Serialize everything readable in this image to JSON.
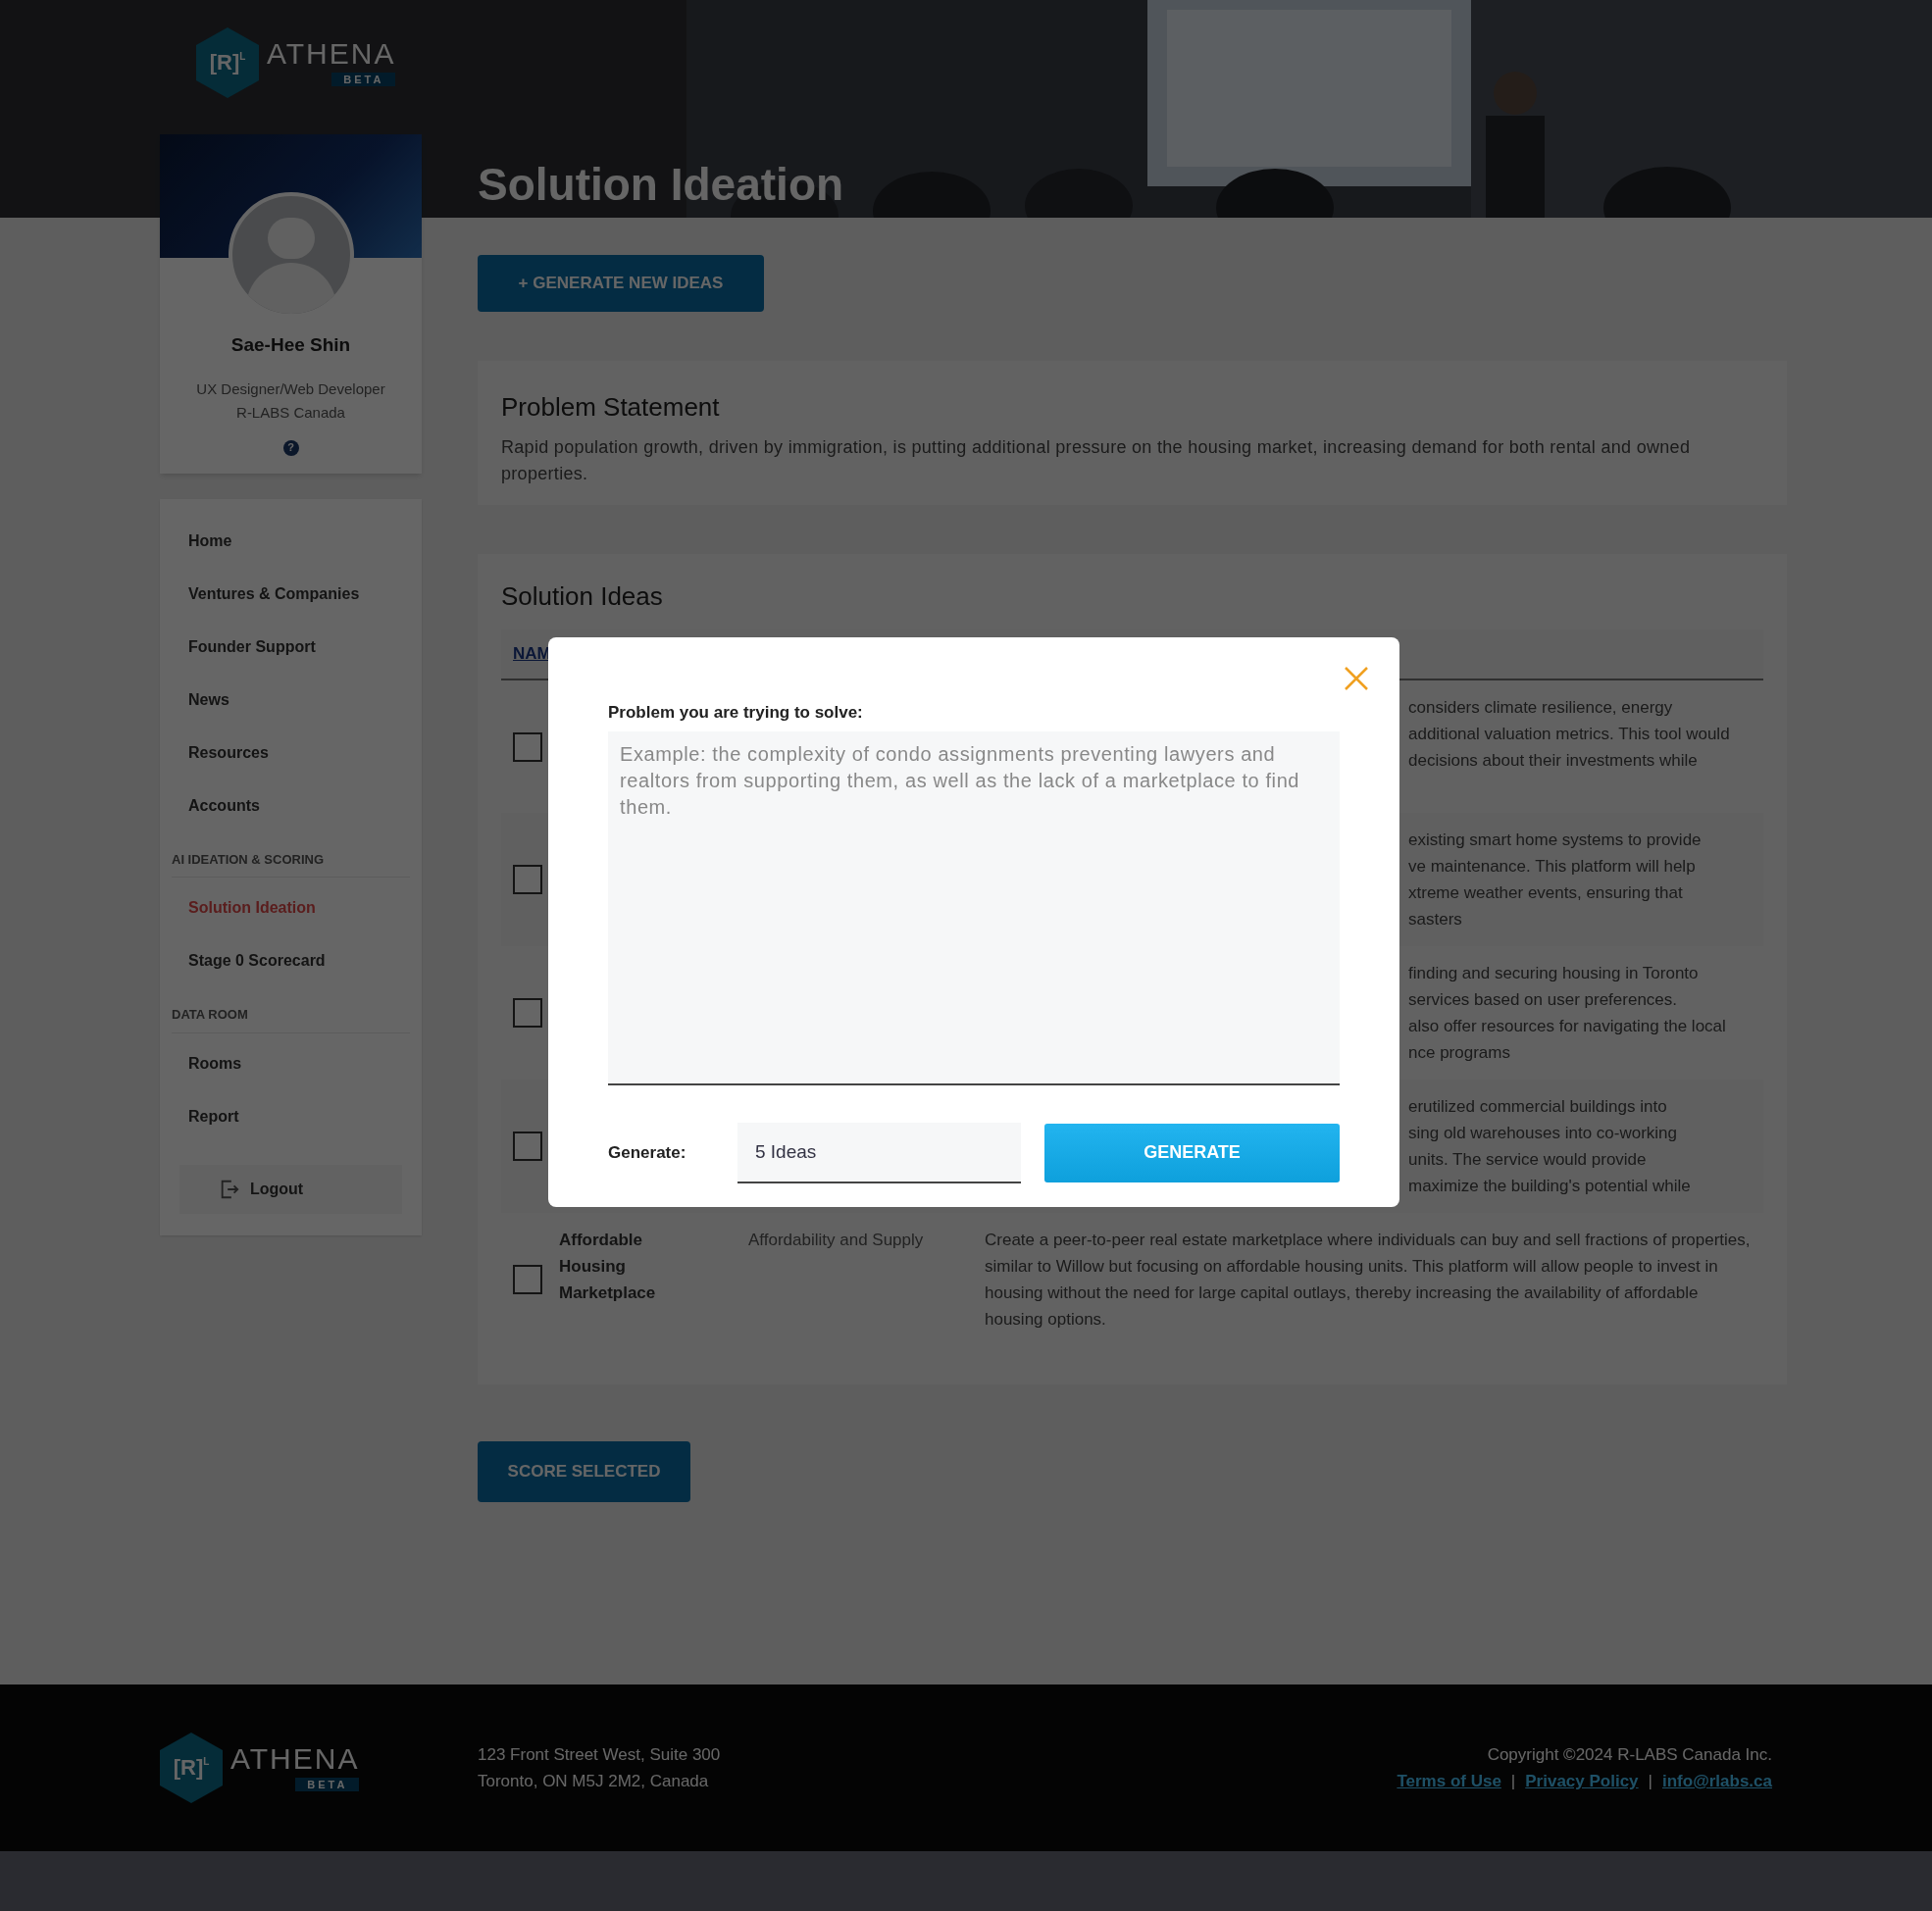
{
  "logo": {
    "mark": "[R]",
    "mark_sup": "L",
    "name": "ATHENA",
    "badge": "BETA"
  },
  "profile": {
    "name": "Sae-Hee Shin",
    "role": "UX Designer/Web Developer",
    "company": "R-LABS Canada",
    "help": "?"
  },
  "nav_groups": [
    {
      "items": [
        {
          "label": "Home",
          "selected": false
        },
        {
          "label": "Ventures & Companies",
          "selected": false
        },
        {
          "label": "Founder Support",
          "selected": false
        },
        {
          "label": "News",
          "selected": false
        },
        {
          "label": "Resources",
          "selected": false
        },
        {
          "label": "Accounts",
          "selected": false
        }
      ]
    },
    {
      "heading": "AI IDEATION & SCORING",
      "items": [
        {
          "label": "Solution Ideation",
          "selected": true
        },
        {
          "label": "Stage 0 Scorecard",
          "selected": false
        }
      ]
    },
    {
      "heading": "DATA ROOM",
      "items": [
        {
          "label": "Rooms",
          "selected": false
        },
        {
          "label": "Report",
          "selected": false
        }
      ]
    }
  ],
  "logout": "Logout",
  "page_title": "Solution Ideation",
  "generate_new_button": "+ GENERATE NEW IDEAS",
  "problem_statement": {
    "title": "Problem Statement",
    "text": "Rapid population growth, driven by immigration, is putting additional pressure on the housing market, increasing demand for both rental and owned properties."
  },
  "solution_ideas": {
    "title": "Solution Ideas",
    "column_1": "NAM",
    "rows": [
      {
        "checked": false,
        "description_lines": [
          "considers climate resilience, energy",
          "additional valuation metrics. This tool would",
          "decisions about their investments while"
        ]
      },
      {
        "checked": false,
        "description_lines": [
          "existing smart home systems to provide",
          "ve maintenance. This platform will help",
          "xtreme weather events, ensuring that",
          "sasters"
        ]
      },
      {
        "checked": false,
        "description_lines": [
          "finding and securing housing in Toronto",
          "services based on user preferences.",
          "also offer resources for navigating the local",
          "nce programs"
        ]
      },
      {
        "checked": false,
        "description_lines": [
          "erutilized commercial buildings into",
          "sing old warehouses into co-working",
          "units. The service would provide",
          "maximize the building's potential while"
        ]
      },
      {
        "checked": false,
        "name": "Affordable Housing Marketplace",
        "category": "Affordability and Supply",
        "description": "Create a peer-to-peer real estate marketplace where individuals can buy and sell fractions of properties, similar to Willow but focusing on affordable housing units. This platform will allow people to invest in housing without the need for large capital outlays, thereby increasing the availability of affordable housing options."
      }
    ]
  },
  "score_button": "SCORE SELECTED",
  "modal": {
    "label": "Problem you are trying to solve:",
    "placeholder": "Example: the complexity of condo assignments preventing lawyers and realtors from supporting them, as well as the lack of a marketplace to find them.",
    "generate_label": "Generate:",
    "count_value": "5 Ideas",
    "button": "GENERATE"
  },
  "footer": {
    "logo": {
      "mark": "[R]",
      "mark_sup": "L",
      "name": "ATHENA",
      "badge": "BETA"
    },
    "address_line_1": "123 Front Street West, Suite 300",
    "address_line_2": "Toronto, ON M5J 2M2, Canada",
    "copyright": "Copyright ©2024 R-LABS Canada Inc.",
    "links": [
      "Terms of Use",
      "Privacy Policy",
      "info@rlabs.ca"
    ],
    "separator": "|"
  }
}
